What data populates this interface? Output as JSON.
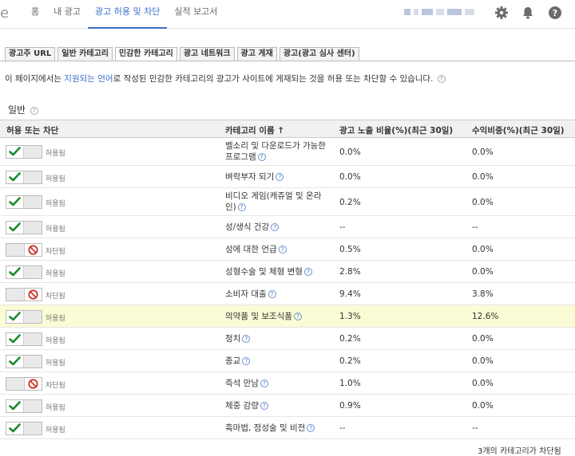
{
  "nav": {
    "brand": "e",
    "links": [
      "홈",
      "내 광고",
      "광고 허용 및 차단",
      "실적 보고서"
    ],
    "active_index": 2
  },
  "icons": {
    "settings": "gear-icon",
    "notifications": "bell-icon",
    "help": "help-icon",
    "info": "question-icon",
    "allowed": "check-icon",
    "blocked": "ban-icon"
  },
  "subtabs": [
    "광고주 URL",
    "일반 카테고리",
    "민감한 카테고리",
    "광고 네트워크",
    "광고 게재",
    "광고(광고 심사 센터)"
  ],
  "active_subtab": 2,
  "description": {
    "before": "이 페이지에서는 ",
    "link": "지원되는 언어",
    "after": "로 작성된 민감한 카테고리의 광고가 사이트에 게재되는 것을 허용 또는 차단할 수 있습니다."
  },
  "section_title": "일반",
  "table": {
    "headers": [
      "허용 또는 차단",
      "카테고리 이름 ↑",
      "광고 노출 비율(%)(최근 30일)",
      "수익비중(%)(최근 30일)"
    ],
    "rows": [
      {
        "status": "허용됨",
        "allowed": true,
        "category": "벨소리 및 다운로드가 가능한 프로그램",
        "impr": "0.0%",
        "rev": "0.0%"
      },
      {
        "status": "허용됨",
        "allowed": true,
        "category": "벼락부자 되기",
        "impr": "0.0%",
        "rev": "0.0%"
      },
      {
        "status": "허용됨",
        "allowed": true,
        "category": "비디오 게임(캐쥬얼 및 온라인)",
        "impr": "0.2%",
        "rev": "0.0%"
      },
      {
        "status": "허용됨",
        "allowed": true,
        "category": "성/생식 건강",
        "impr": "--",
        "rev": "--"
      },
      {
        "status": "차단됨",
        "allowed": false,
        "category": "성에 대한 언급",
        "impr": "0.5%",
        "rev": "0.0%"
      },
      {
        "status": "허용됨",
        "allowed": true,
        "category": "성형수술 및 체형 변형",
        "impr": "2.8%",
        "rev": "0.0%"
      },
      {
        "status": "차단됨",
        "allowed": false,
        "category": "소비자 대출",
        "impr": "9.4%",
        "rev": "3.8%"
      },
      {
        "status": "허용됨",
        "allowed": true,
        "category": "의약품 및 보조식품",
        "impr": "1.3%",
        "rev": "12.6%",
        "highlight": true
      },
      {
        "status": "허용됨",
        "allowed": true,
        "category": "정치",
        "impr": "0.2%",
        "rev": "0.0%"
      },
      {
        "status": "허용됨",
        "allowed": true,
        "category": "종교",
        "impr": "0.2%",
        "rev": "0.0%"
      },
      {
        "status": "차단됨",
        "allowed": false,
        "category": "즉석 만남",
        "impr": "1.0%",
        "rev": "0.0%"
      },
      {
        "status": "허용됨",
        "allowed": true,
        "category": "체중 감량",
        "impr": "0.9%",
        "rev": "0.0%"
      },
      {
        "status": "허용됨",
        "allowed": true,
        "category": "흑마법, 점성술 및 비전",
        "impr": "--",
        "rev": "--"
      }
    ]
  },
  "footer": "3개의 카테고리가 차단됨",
  "colors": {
    "accent": "#3b6ec8",
    "check": "#1b8a2e",
    "ban": "#d0342c",
    "highlight": "#fbfbd6"
  }
}
